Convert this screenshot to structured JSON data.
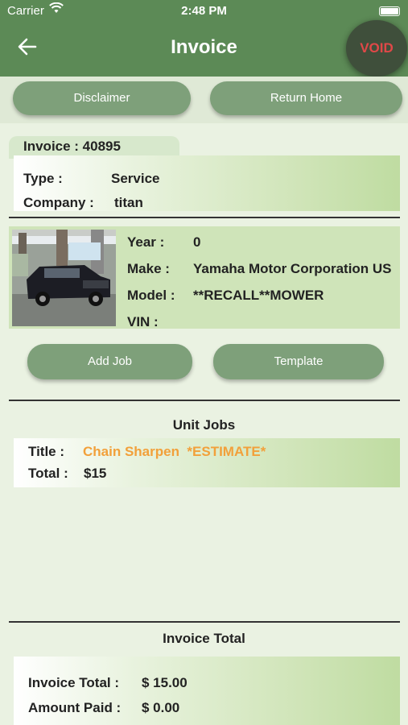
{
  "status": {
    "carrier": "Carrier",
    "time": "2:48 PM"
  },
  "nav": {
    "title": "Invoice",
    "void_label": "VOID"
  },
  "actions": {
    "disclaimer": "Disclaimer",
    "return_home": "Return Home"
  },
  "invoice": {
    "number_label": "Invoice : 40895",
    "type_label": "Type :",
    "type_value": "Service",
    "company_label": "Company :",
    "company_value": "titan"
  },
  "vehicle": {
    "year_label": "Year :",
    "year_value": "0",
    "make_label": "Make :",
    "make_value": "Yamaha Motor Corporation US",
    "model_label": "Model :",
    "model_value": "**RECALL**MOWER",
    "vin_label": "VIN :",
    "vin_value": ""
  },
  "job_actions": {
    "add_job": "Add Job",
    "template": "Template"
  },
  "unit_jobs": {
    "title": "Unit Jobs",
    "title_label": "Title :",
    "title_value": "Chain Sharpen  *ESTIMATE*",
    "total_label": "Total :",
    "total_value": "$15"
  },
  "totals": {
    "title": "Invoice Total",
    "invoice_total_label": "Invoice Total :",
    "invoice_total_value": "$ 15.00",
    "amount_paid_label": "Amount Paid :",
    "amount_paid_value": "$ 0.00"
  },
  "colors": {
    "header": "#5c8a56",
    "button": "#7ea07a",
    "void_text": "#e04848",
    "highlight": "#f2a03a",
    "background": "#eaf2e2"
  }
}
